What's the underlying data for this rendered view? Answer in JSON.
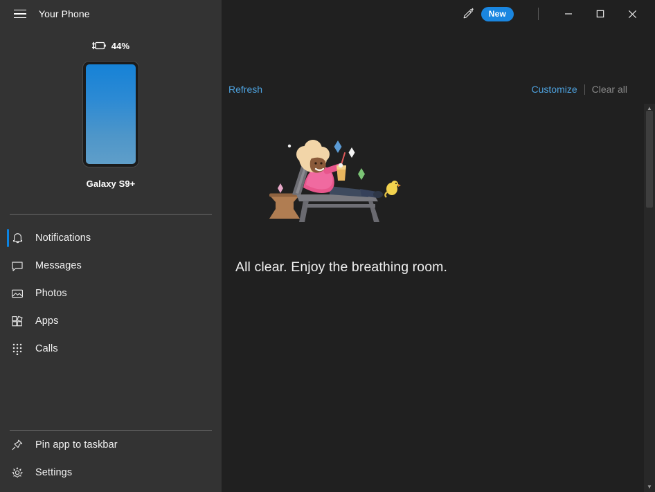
{
  "window": {
    "app_title": "Your Phone",
    "menu_icon": "hamburger-menu-icon",
    "feedback_icon": "pen-feedback-icon",
    "new_badge": "New",
    "minimize": "—",
    "maximize": "□",
    "close": "✕"
  },
  "sidebar": {
    "battery": {
      "percent": "44%",
      "icon": "battery-charging-icon"
    },
    "device": {
      "name": "Galaxy S9+",
      "screen_preview": "phone-screen-preview"
    },
    "nav_items": [
      {
        "label": "Notifications",
        "icon": "bell-icon",
        "selected": true
      },
      {
        "label": "Messages",
        "icon": "message-bubble-icon",
        "selected": false
      },
      {
        "label": "Photos",
        "icon": "photo-icon",
        "selected": false
      },
      {
        "label": "Apps",
        "icon": "apps-grid-icon",
        "selected": false
      },
      {
        "label": "Calls",
        "icon": "dialpad-icon",
        "selected": false
      }
    ],
    "bottom_items": [
      {
        "label": "Pin app to taskbar",
        "icon": "pin-icon"
      },
      {
        "label": "Settings",
        "icon": "gear-icon"
      }
    ]
  },
  "main": {
    "refresh_label": "Refresh",
    "customize_label": "Customize",
    "clear_all_label": "Clear all",
    "empty_state": {
      "message": "All clear. Enjoy the breathing room.",
      "illustration": "person-relaxing-on-lounge-chair"
    },
    "scrollbar": {
      "up_arrow": "▲",
      "down_arrow": "▼"
    }
  },
  "colors": {
    "sidebar_bg": "#333333",
    "main_bg": "#202020",
    "accent_link": "#4ea3e0",
    "accent_badge": "#1a86e0",
    "selected_indicator": "#0b84e3",
    "disabled_text": "#8a8a8a"
  }
}
